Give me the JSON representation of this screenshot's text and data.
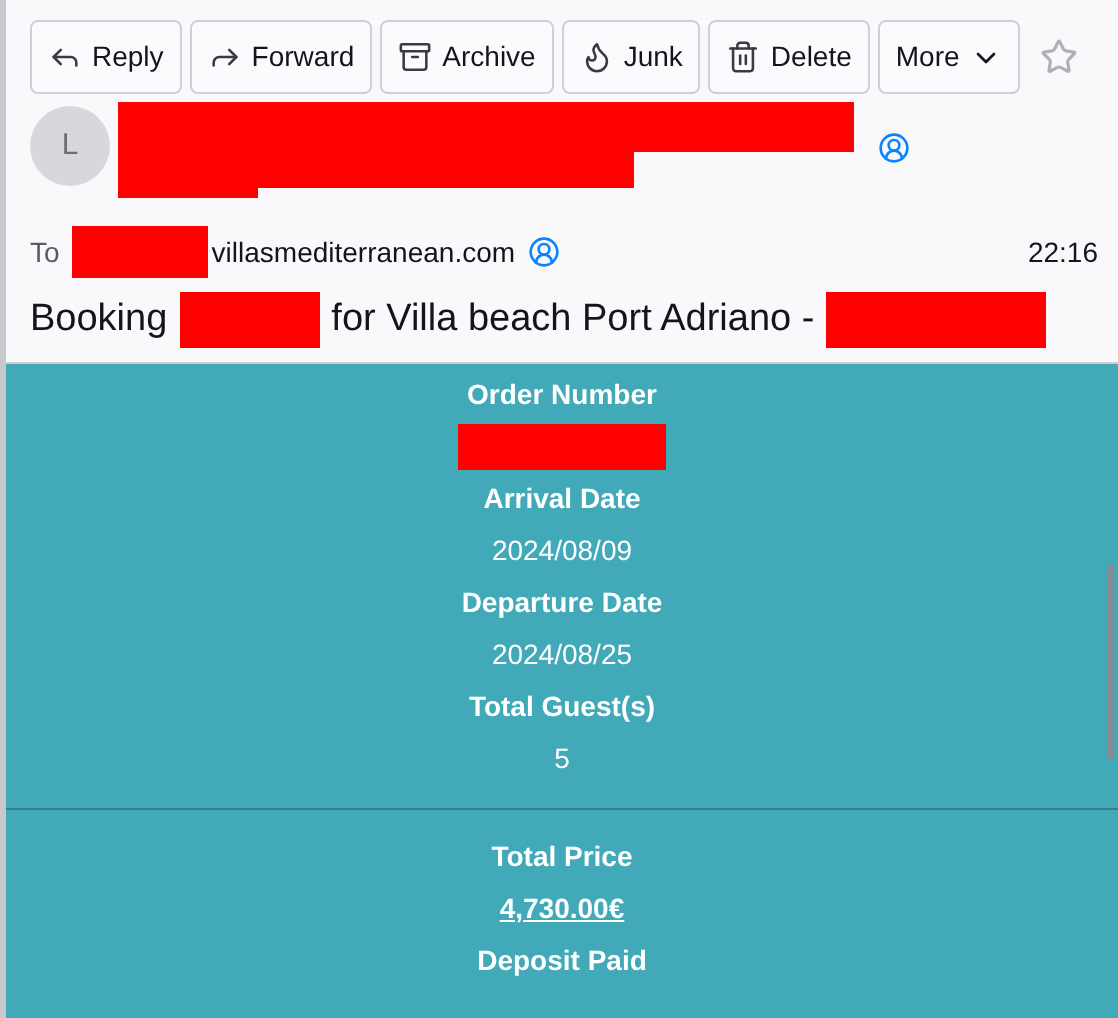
{
  "toolbar": [
    {
      "kind": "reply",
      "label": "Reply"
    },
    {
      "kind": "forward",
      "label": "Forward"
    },
    {
      "kind": "archive",
      "label": "Archive"
    },
    {
      "kind": "junk",
      "label": "Junk"
    },
    {
      "kind": "delete",
      "label": "Delete"
    },
    {
      "kind": "more",
      "label": "More"
    }
  ],
  "sender": {
    "avatar": "L",
    "name": [
      {
        "kind": "redacted"
      }
    ]
  },
  "to": {
    "label": "To",
    "address": [
      {
        "kind": "redacted"
      },
      {
        "kind": "text",
        "text": "villasmediterranean.com"
      }
    ]
  },
  "time": "22:16",
  "subject": [
    {
      "kind": "text",
      "text": "Booking"
    },
    {
      "kind": "redacted"
    },
    {
      "kind": "text",
      "text": "for Villa beach Port Adriano -"
    },
    {
      "kind": "redacted"
    }
  ],
  "body": {
    "sections": [
      {
        "fields": [
          {
            "kind": "redacted",
            "label": "Order Number"
          },
          {
            "label": "Arrival Date",
            "value": "2024/08/09"
          },
          {
            "label": "Departure Date",
            "value": "2024/08/25"
          },
          {
            "label": "Total Guest(s)",
            "value": "5"
          }
        ]
      },
      {
        "fields": [
          {
            "label": "Total Price",
            "value": "4,730.00€",
            "underline": true
          },
          {
            "label": "Deposit Paid"
          }
        ]
      }
    ]
  }
}
